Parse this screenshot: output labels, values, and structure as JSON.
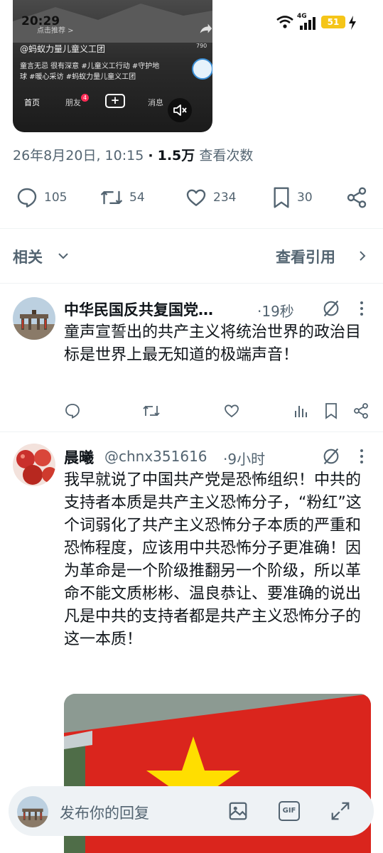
{
  "status_bar": {
    "time": "20:29",
    "network": "4G",
    "battery": "51"
  },
  "video": {
    "top_text": "点击推荐 >",
    "handle": "@蚂蚁力量儿童义工团",
    "desc_line1": "童言无忌 很有深意 #儿童义工行动 #守护地",
    "desc_line2": "球 #暖心采访 #蚂蚁力量儿童义工团",
    "count": "790",
    "nav": {
      "home": "首页",
      "friends": "朋友",
      "friends_badge": "4",
      "messages": "消息",
      "plus": "+"
    }
  },
  "tweet_meta": {
    "date": "26年8月20日, 10:15",
    "separator": "·",
    "views": "1.5万",
    "views_label": "查看次数"
  },
  "actions": {
    "replies": "105",
    "retweets": "54",
    "likes": "234",
    "bookmarks": "30"
  },
  "section": {
    "related": "相关",
    "view_quotes": "查看引用"
  },
  "replies": [
    {
      "author": "中华民国反共复国党…",
      "handle": "",
      "time": "·19秒",
      "text": "童声宣誓出的共产主义将统治世界的政治目标是世界上最无知道的极端声音！"
    },
    {
      "author": "晨曦",
      "handle": "@chnx351616",
      "time": "·9小时",
      "text": "我早就说了中国共产党是恐怖组织！中共的支持者本质是共产主义恐怖分子，“粉红”这个词弱化了共产主义恐怖分子本质的严重和恐怖程度，应该用中共恐怖分子更准确！因为革命是一个阶级推翻另一个阶级，所以革命不能文质彬彬、温良恭让、要准确的说出凡是中共的支持者都是共产主义恐怖分子的这一本质！"
    }
  ],
  "reply_bar": {
    "placeholder": "发布你的回复",
    "gif": "GIF"
  },
  "colors": {
    "text": "#0f1419",
    "secondary": "#536471",
    "flag_red": "#da251d",
    "flag_star": "#ffde00"
  }
}
